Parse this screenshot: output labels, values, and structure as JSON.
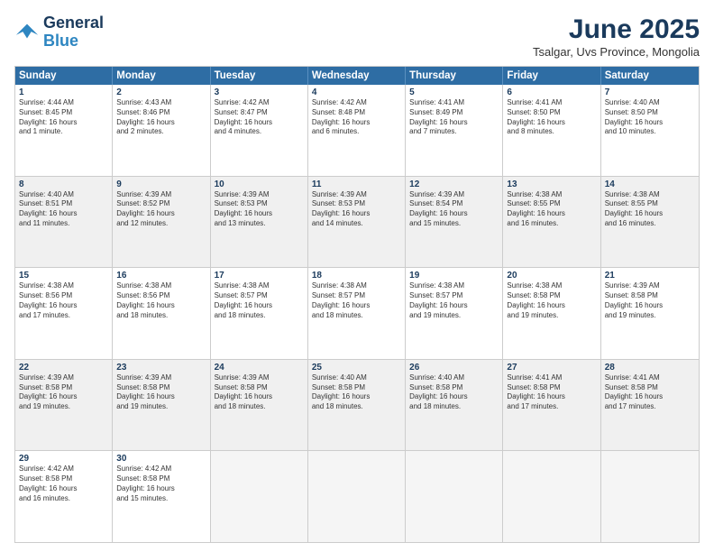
{
  "logo": {
    "line1": "General",
    "line2": "Blue"
  },
  "title": "June 2025",
  "subtitle": "Tsalgar, Uvs Province, Mongolia",
  "header_days": [
    "Sunday",
    "Monday",
    "Tuesday",
    "Wednesday",
    "Thursday",
    "Friday",
    "Saturday"
  ],
  "rows": [
    [
      {
        "day": "1",
        "lines": [
          "Sunrise: 4:44 AM",
          "Sunset: 8:45 PM",
          "Daylight: 16 hours",
          "and 1 minute."
        ]
      },
      {
        "day": "2",
        "lines": [
          "Sunrise: 4:43 AM",
          "Sunset: 8:46 PM",
          "Daylight: 16 hours",
          "and 2 minutes."
        ]
      },
      {
        "day": "3",
        "lines": [
          "Sunrise: 4:42 AM",
          "Sunset: 8:47 PM",
          "Daylight: 16 hours",
          "and 4 minutes."
        ]
      },
      {
        "day": "4",
        "lines": [
          "Sunrise: 4:42 AM",
          "Sunset: 8:48 PM",
          "Daylight: 16 hours",
          "and 6 minutes."
        ]
      },
      {
        "day": "5",
        "lines": [
          "Sunrise: 4:41 AM",
          "Sunset: 8:49 PM",
          "Daylight: 16 hours",
          "and 7 minutes."
        ]
      },
      {
        "day": "6",
        "lines": [
          "Sunrise: 4:41 AM",
          "Sunset: 8:50 PM",
          "Daylight: 16 hours",
          "and 8 minutes."
        ]
      },
      {
        "day": "7",
        "lines": [
          "Sunrise: 4:40 AM",
          "Sunset: 8:50 PM",
          "Daylight: 16 hours",
          "and 10 minutes."
        ]
      }
    ],
    [
      {
        "day": "8",
        "lines": [
          "Sunrise: 4:40 AM",
          "Sunset: 8:51 PM",
          "Daylight: 16 hours",
          "and 11 minutes."
        ]
      },
      {
        "day": "9",
        "lines": [
          "Sunrise: 4:39 AM",
          "Sunset: 8:52 PM",
          "Daylight: 16 hours",
          "and 12 minutes."
        ]
      },
      {
        "day": "10",
        "lines": [
          "Sunrise: 4:39 AM",
          "Sunset: 8:53 PM",
          "Daylight: 16 hours",
          "and 13 minutes."
        ]
      },
      {
        "day": "11",
        "lines": [
          "Sunrise: 4:39 AM",
          "Sunset: 8:53 PM",
          "Daylight: 16 hours",
          "and 14 minutes."
        ]
      },
      {
        "day": "12",
        "lines": [
          "Sunrise: 4:39 AM",
          "Sunset: 8:54 PM",
          "Daylight: 16 hours",
          "and 15 minutes."
        ]
      },
      {
        "day": "13",
        "lines": [
          "Sunrise: 4:38 AM",
          "Sunset: 8:55 PM",
          "Daylight: 16 hours",
          "and 16 minutes."
        ]
      },
      {
        "day": "14",
        "lines": [
          "Sunrise: 4:38 AM",
          "Sunset: 8:55 PM",
          "Daylight: 16 hours",
          "and 16 minutes."
        ]
      }
    ],
    [
      {
        "day": "15",
        "lines": [
          "Sunrise: 4:38 AM",
          "Sunset: 8:56 PM",
          "Daylight: 16 hours",
          "and 17 minutes."
        ]
      },
      {
        "day": "16",
        "lines": [
          "Sunrise: 4:38 AM",
          "Sunset: 8:56 PM",
          "Daylight: 16 hours",
          "and 18 minutes."
        ]
      },
      {
        "day": "17",
        "lines": [
          "Sunrise: 4:38 AM",
          "Sunset: 8:57 PM",
          "Daylight: 16 hours",
          "and 18 minutes."
        ]
      },
      {
        "day": "18",
        "lines": [
          "Sunrise: 4:38 AM",
          "Sunset: 8:57 PM",
          "Daylight: 16 hours",
          "and 18 minutes."
        ]
      },
      {
        "day": "19",
        "lines": [
          "Sunrise: 4:38 AM",
          "Sunset: 8:57 PM",
          "Daylight: 16 hours",
          "and 19 minutes."
        ]
      },
      {
        "day": "20",
        "lines": [
          "Sunrise: 4:38 AM",
          "Sunset: 8:58 PM",
          "Daylight: 16 hours",
          "and 19 minutes."
        ]
      },
      {
        "day": "21",
        "lines": [
          "Sunrise: 4:39 AM",
          "Sunset: 8:58 PM",
          "Daylight: 16 hours",
          "and 19 minutes."
        ]
      }
    ],
    [
      {
        "day": "22",
        "lines": [
          "Sunrise: 4:39 AM",
          "Sunset: 8:58 PM",
          "Daylight: 16 hours",
          "and 19 minutes."
        ]
      },
      {
        "day": "23",
        "lines": [
          "Sunrise: 4:39 AM",
          "Sunset: 8:58 PM",
          "Daylight: 16 hours",
          "and 19 minutes."
        ]
      },
      {
        "day": "24",
        "lines": [
          "Sunrise: 4:39 AM",
          "Sunset: 8:58 PM",
          "Daylight: 16 hours",
          "and 18 minutes."
        ]
      },
      {
        "day": "25",
        "lines": [
          "Sunrise: 4:40 AM",
          "Sunset: 8:58 PM",
          "Daylight: 16 hours",
          "and 18 minutes."
        ]
      },
      {
        "day": "26",
        "lines": [
          "Sunrise: 4:40 AM",
          "Sunset: 8:58 PM",
          "Daylight: 16 hours",
          "and 18 minutes."
        ]
      },
      {
        "day": "27",
        "lines": [
          "Sunrise: 4:41 AM",
          "Sunset: 8:58 PM",
          "Daylight: 16 hours",
          "and 17 minutes."
        ]
      },
      {
        "day": "28",
        "lines": [
          "Sunrise: 4:41 AM",
          "Sunset: 8:58 PM",
          "Daylight: 16 hours",
          "and 17 minutes."
        ]
      }
    ],
    [
      {
        "day": "29",
        "lines": [
          "Sunrise: 4:42 AM",
          "Sunset: 8:58 PM",
          "Daylight: 16 hours",
          "and 16 minutes."
        ]
      },
      {
        "day": "30",
        "lines": [
          "Sunrise: 4:42 AM",
          "Sunset: 8:58 PM",
          "Daylight: 16 hours",
          "and 15 minutes."
        ]
      },
      {
        "day": "",
        "lines": []
      },
      {
        "day": "",
        "lines": []
      },
      {
        "day": "",
        "lines": []
      },
      {
        "day": "",
        "lines": []
      },
      {
        "day": "",
        "lines": []
      }
    ]
  ]
}
